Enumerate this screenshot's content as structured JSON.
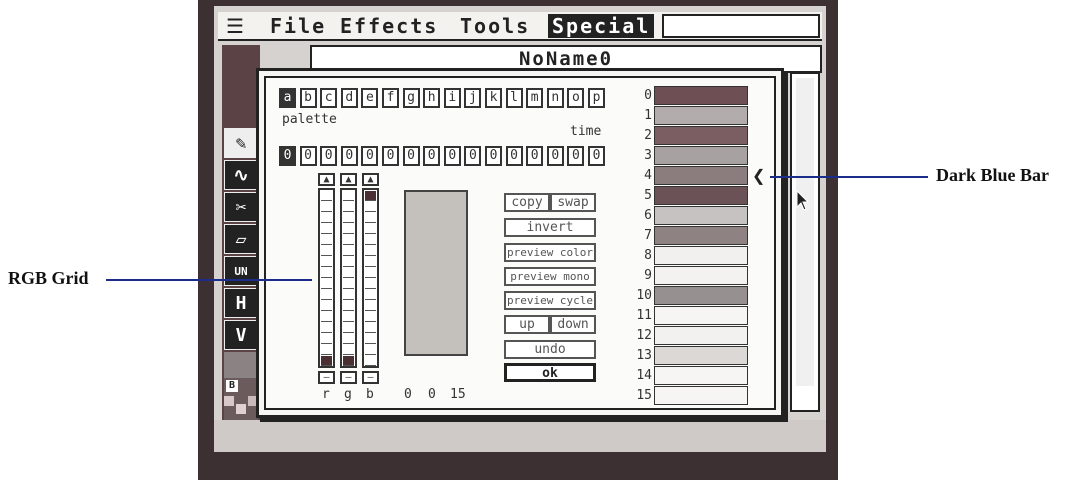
{
  "menubar": {
    "apple": "",
    "items": [
      "File",
      "Effects",
      "Tools",
      "Special"
    ],
    "active": "Special"
  },
  "document": {
    "title": "NoName0"
  },
  "tools": [
    {
      "icon": "pencil-icon",
      "glyph": "✎"
    },
    {
      "icon": "curve-icon",
      "glyph": "∿"
    },
    {
      "icon": "scissors-icon",
      "glyph": "✂"
    },
    {
      "icon": "eraser-icon",
      "glyph": "▱"
    },
    {
      "icon": "undo-icon",
      "glyph": "UN"
    },
    {
      "icon": "h-icon",
      "glyph": "H"
    },
    {
      "icon": "v-icon",
      "glyph": "V"
    }
  ],
  "palette_letters": [
    "a",
    "b",
    "c",
    "d",
    "e",
    "f",
    "g",
    "h",
    "i",
    "j",
    "k",
    "l",
    "m",
    "n",
    "o",
    "p"
  ],
  "selected_letter": "a",
  "labels": {
    "palette": "palette",
    "time": "time"
  },
  "time_values": [
    "0",
    "0",
    "0",
    "0",
    "0",
    "0",
    "0",
    "0",
    "0",
    "0",
    "0",
    "0",
    "0",
    "0",
    "0",
    "0"
  ],
  "rgb": {
    "channels": [
      "r",
      "g",
      "b"
    ],
    "readout": [
      "0",
      "0",
      "15"
    ]
  },
  "buttons": {
    "copy": "copy",
    "swap": "swap",
    "invert": "invert",
    "preview_color": "preview color",
    "preview_mono": "preview mono",
    "preview_cycle": "preview cycle",
    "up": "up",
    "down": "down",
    "undo": "undo",
    "ok": "ok"
  },
  "palette_entries": [
    {
      "index": "0",
      "color": "#6e5054"
    },
    {
      "index": "1",
      "color": "#b2acad"
    },
    {
      "index": "2",
      "color": "#7a5e62"
    },
    {
      "index": "3",
      "color": "#a8a1a2"
    },
    {
      "index": "4",
      "color": "#8b7d7e"
    },
    {
      "index": "5",
      "color": "#6b5256"
    },
    {
      "index": "6",
      "color": "#c7c2c2"
    },
    {
      "index": "7",
      "color": "#8e8283"
    },
    {
      "index": "8",
      "color": "#f2f0ee"
    },
    {
      "index": "9",
      "color": "#f4f2f0"
    },
    {
      "index": "10",
      "color": "#979091"
    },
    {
      "index": "11",
      "color": "#f7f5f3"
    },
    {
      "index": "12",
      "color": "#f3f1ef"
    },
    {
      "index": "13",
      "color": "#dcd8d6"
    },
    {
      "index": "14",
      "color": "#f7f5f3"
    },
    {
      "index": "15",
      "color": "#f7f5f3"
    }
  ],
  "callouts": {
    "rgb_grid": "RGB Grid",
    "dark_blue_bar": "Dark Blue Bar"
  },
  "colors": {
    "callout_line": "#1a2d8a",
    "monitor": "#3d3032"
  }
}
